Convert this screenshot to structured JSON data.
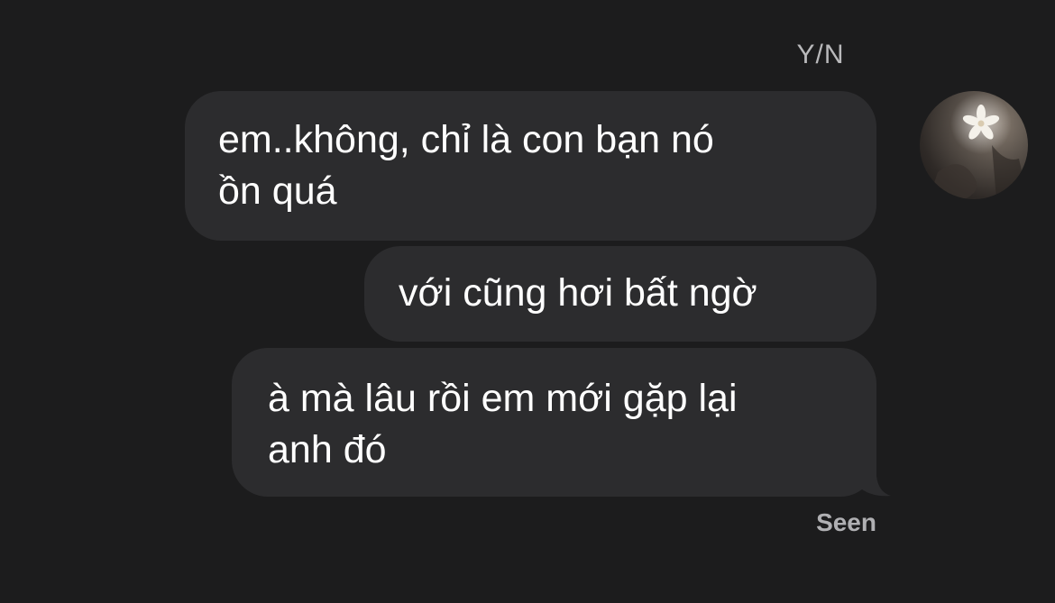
{
  "chat": {
    "sender_name": "Y/N",
    "messages": [
      {
        "text": "em..không, chỉ là con bạn nó\nồn quá"
      },
      {
        "text": "với cũng hơi bất ngờ"
      },
      {
        "text": "à mà lâu rồi em mới gặp lại\nanh đó"
      }
    ],
    "status": "Seen"
  },
  "colors": {
    "background": "#1c1c1d",
    "bubble": "#2c2c2e",
    "text": "#ffffff",
    "meta_text": "#b0b0b3"
  },
  "icons": {
    "avatar": "flower-avatar-icon"
  }
}
